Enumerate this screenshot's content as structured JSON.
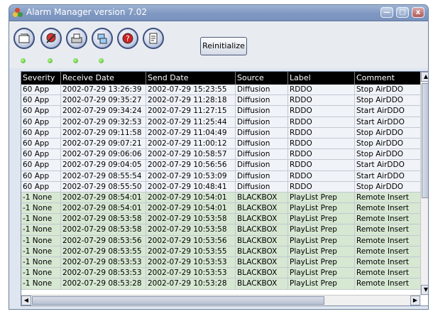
{
  "window": {
    "title": "Alarm Manager version 7.02",
    "minimize_label": "—",
    "maximize_label": "□",
    "close_label": "x"
  },
  "toolbar": {
    "reinitialize_label": "Reinitialize",
    "tools": [
      "clear-alarm-icon",
      "acknowledge-icon",
      "print-icon",
      "network-icon",
      "help-icon",
      "notes-icon"
    ],
    "status_color": "#3da320"
  },
  "table": {
    "columns": [
      "Severity",
      "Receive Date",
      "Send Date",
      "Source",
      "Label",
      "Comment"
    ],
    "rows": [
      [
        "60 App",
        "2002-07-29 13:26:39",
        "2002-07-29 15:23:55",
        "Diffusion",
        "RDDO",
        "Stop AirDDO"
      ],
      [
        "60 App",
        "2002-07-29 09:35:27",
        "2002-07-29 11:28:18",
        "Diffusion",
        "RDDO",
        "Stop AirDDO"
      ],
      [
        "60 App",
        "2002-07-29 09:34:24",
        "2002-07-29 11:27:15",
        "Diffusion",
        "RDDO",
        "Start AirDDO"
      ],
      [
        "60 App",
        "2002-07-29 09:32:53",
        "2002-07-29 11:25:44",
        "Diffusion",
        "RDDO",
        "Start AirDDO"
      ],
      [
        "60 App",
        "2002-07-29 09:11:58",
        "2002-07-29 11:04:49",
        "Diffusion",
        "RDDO",
        "Stop AirDDO"
      ],
      [
        "60 App",
        "2002-07-29 09:07:21",
        "2002-07-29 11:00:12",
        "Diffusion",
        "RDDO",
        "Stop AirDDO"
      ],
      [
        "60 App",
        "2002-07-29 09:06:06",
        "2002-07-29 10:58:57",
        "Diffusion",
        "RDDO",
        "Stop AirDDO"
      ],
      [
        "60 App",
        "2002-07-29 09:04:05",
        "2002-07-29 10:56:56",
        "Diffusion",
        "RDDO",
        "Start AirDDO"
      ],
      [
        "60 App",
        "2002-07-29 08:55:54",
        "2002-07-29 10:53:09",
        "Diffusion",
        "RDDO",
        "Start AirDDO"
      ],
      [
        "60 App",
        "2002-07-29 08:55:50",
        "2002-07-29 10:48:41",
        "Diffusion",
        "RDDO",
        "Stop AirDDO"
      ],
      [
        "-1 None",
        "2002-07-29 08:54:01",
        "2002-07-29 10:54:01",
        "BLACKBOX",
        "PlayList Prep",
        "Remote Insert"
      ],
      [
        "-1 None",
        "2002-07-29 08:54:01",
        "2002-07-29 10:54:01",
        "BLACKBOX",
        "PlayList Prep",
        "Remote Insert"
      ],
      [
        "-1 None",
        "2002-07-29 08:53:58",
        "2002-07-29 10:53:58",
        "BLACKBOX",
        "PlayList Prep",
        "Remote Insert"
      ],
      [
        "-1 None",
        "2002-07-29 08:53:58",
        "2002-07-29 10:53:58",
        "BLACKBOX",
        "PlayList Prep",
        "Remote Insert"
      ],
      [
        "-1 None",
        "2002-07-29 08:53:56",
        "2002-07-29 10:53:56",
        "BLACKBOX",
        "PlayList Prep",
        "Remote Insert"
      ],
      [
        "-1 None",
        "2002-07-29 08:53:55",
        "2002-07-29 10:53:55",
        "BLACKBOX",
        "PlayList Prep",
        "Remote Insert"
      ],
      [
        "-1 None",
        "2002-07-29 08:53:53",
        "2002-07-29 10:53:53",
        "BLACKBOX",
        "PlayList Prep",
        "Remote Insert"
      ],
      [
        "-1 None",
        "2002-07-29 08:53:53",
        "2002-07-29 10:53:53",
        "BLACKBOX",
        "PlayList Prep",
        "Remote Insert"
      ],
      [
        "-1 None",
        "2002-07-29 08:53:28",
        "2002-07-29 10:53:28",
        "BLACKBOX",
        "PlayList Prep",
        "Remote Insert"
      ]
    ],
    "row_colors": {
      "app": "#f0f3f8",
      "none": "#d6e7d2"
    }
  },
  "scrollbars": {
    "up_label": "▲",
    "down_label": "▼",
    "left_label": "◀",
    "right_label": "▶"
  }
}
